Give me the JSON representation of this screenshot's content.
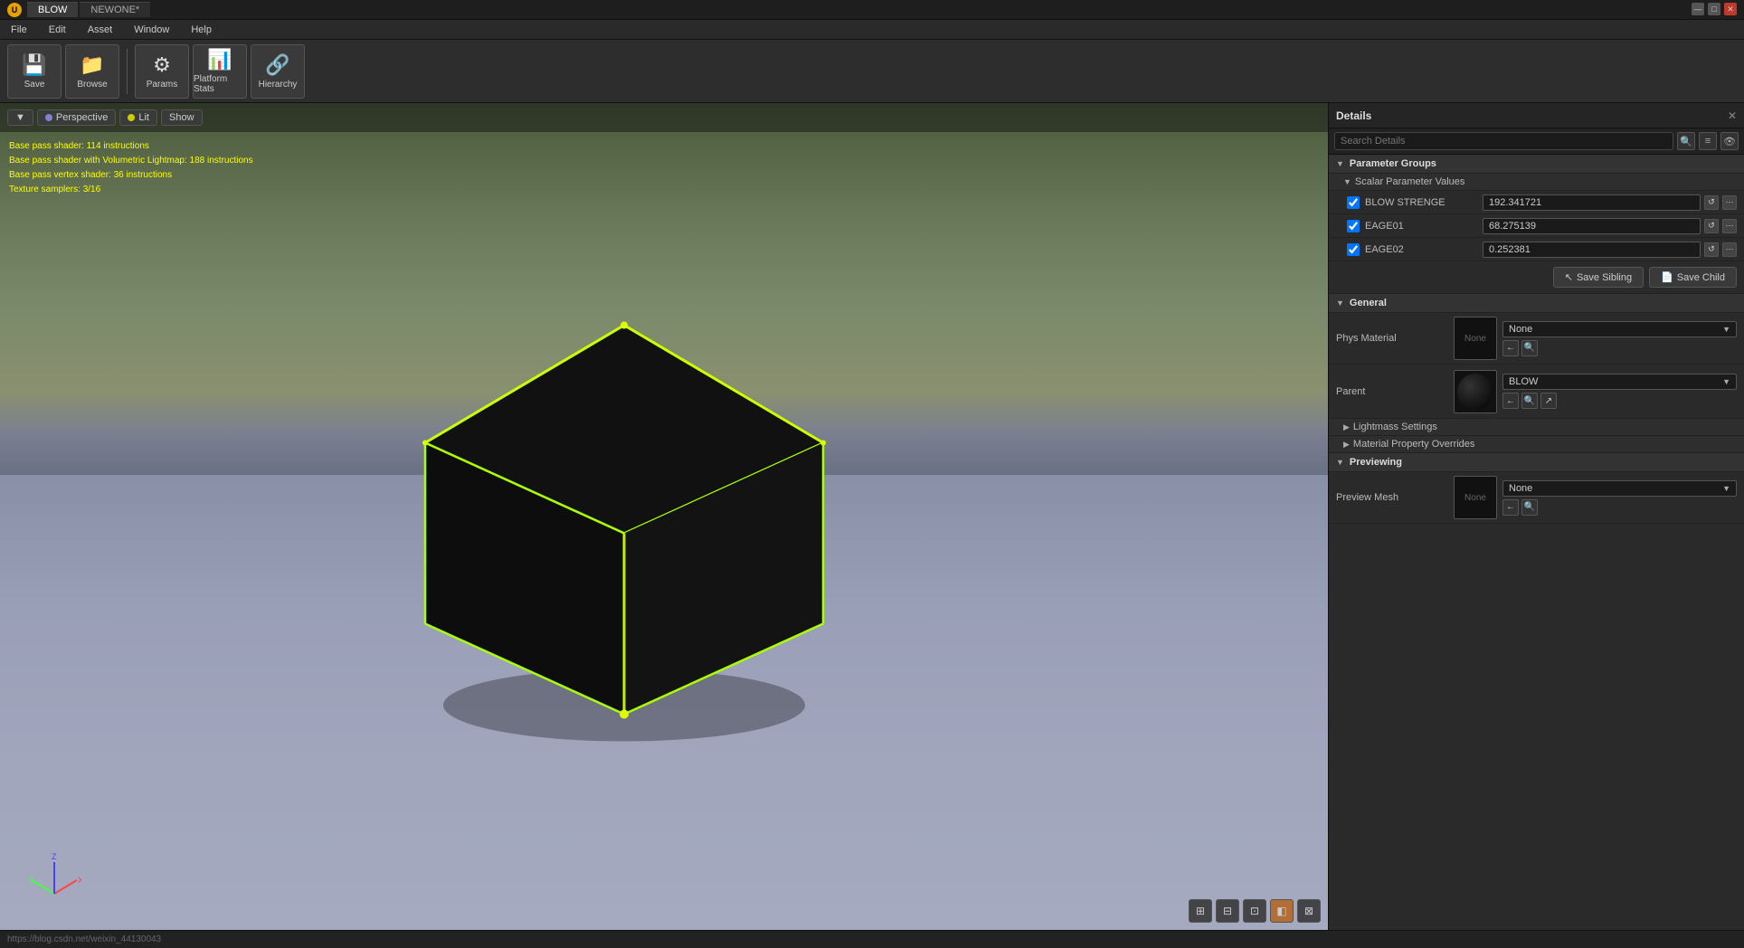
{
  "titlebar": {
    "logo": "U",
    "tabs": [
      {
        "label": "BLOW",
        "active": true
      },
      {
        "label": "NEWONE*",
        "active": false
      }
    ],
    "controls": [
      "—",
      "□",
      "✕"
    ]
  },
  "menubar": {
    "items": [
      "File",
      "Edit",
      "Asset",
      "Window",
      "Help"
    ]
  },
  "toolbar": {
    "buttons": [
      {
        "label": "Save",
        "icon": "💾"
      },
      {
        "label": "Browse",
        "icon": "📁"
      },
      {
        "label": "Params",
        "icon": "⚙"
      },
      {
        "label": "Platform Stats",
        "icon": "📊"
      },
      {
        "label": "Hierarchy",
        "icon": "🔗"
      }
    ]
  },
  "viewport": {
    "perspective_label": "Perspective",
    "lit_label": "Lit",
    "show_label": "Show",
    "debug_lines": [
      "Base pass shader: 114 instructions",
      "Base pass shader with Volumetric Lightmap: 188 instructions",
      "Base pass vertex shader: 36 instructions",
      "Texture samplers: 3/16"
    ],
    "bottom_icons": [
      "🔳",
      "🔲",
      "⬜",
      "🟧",
      "⬛"
    ],
    "url": "https://blog.csdn.net/weixin_44130043"
  },
  "details_panel": {
    "title": "Details",
    "close_label": "✕",
    "search_placeholder": "Search Details",
    "sections": {
      "parameter_groups": {
        "label": "Parameter Groups",
        "scalar_values": {
          "label": "Scalar Parameter Values",
          "params": [
            {
              "checked": true,
              "name": "BLOW STRENGE",
              "value": "192.341721"
            },
            {
              "checked": true,
              "name": "EAGE01",
              "value": "68.275139"
            },
            {
              "checked": true,
              "name": "EAGE02",
              "value": "0.252381"
            }
          ]
        }
      },
      "save_sibling": "↖ Save Sibling",
      "save_child": "📄 Save Child",
      "general": {
        "label": "General",
        "phys_material": {
          "label": "Phys Material",
          "thumbnail_label": "None",
          "dropdown_value": "None"
        },
        "parent": {
          "label": "Parent",
          "dropdown_value": "BLOW"
        }
      },
      "lightmass_settings": {
        "label": "Lightmass Settings"
      },
      "material_property_overrides": {
        "label": "Material Property Overrides"
      },
      "previewing": {
        "label": "Previewing",
        "preview_mesh": {
          "label": "Preview Mesh",
          "thumbnail_label": "None",
          "dropdown_value": "None"
        }
      }
    }
  }
}
